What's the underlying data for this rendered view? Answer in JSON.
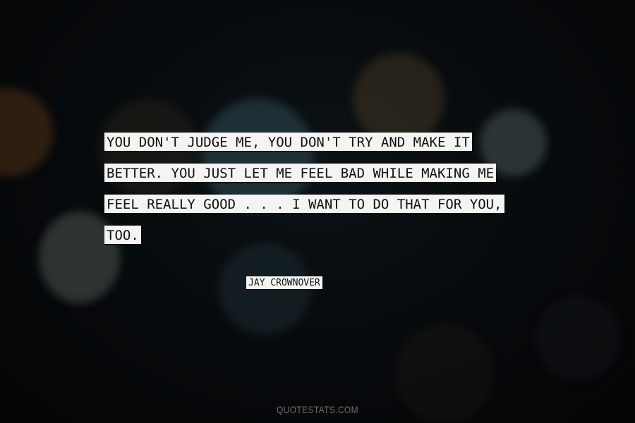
{
  "quote": {
    "lines": [
      "YOU DON'T JUDGE ME, YOU DON'T TRY AND MAKE IT",
      "BETTER. YOU JUST LET ME FEEL BAD WHILE MAKING ME",
      "FEEL REALLY GOOD . . . I WANT TO DO THAT FOR YOU,",
      "TOO."
    ]
  },
  "author": "JAY CROWNOVER",
  "watermark": "QUOTESTATS.COM"
}
